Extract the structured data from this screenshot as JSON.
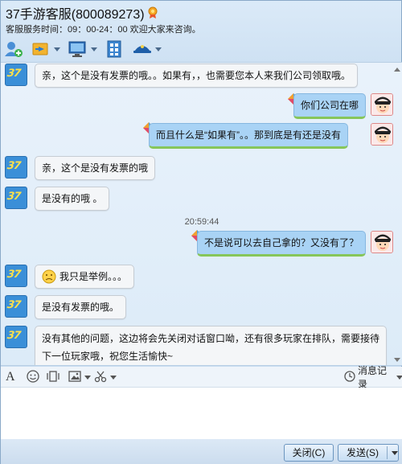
{
  "window": {
    "title": "37手游客服(800089273)",
    "service_hours": "客服服务时间：09：00-24：00 欢迎大家来咨询。"
  },
  "toolbar": {
    "buttons": [
      {
        "icon": "add-contact-icon"
      },
      {
        "icon": "transfer-file-icon"
      },
      {
        "icon": "remote-desktop-icon"
      },
      {
        "icon": "app-grid-icon"
      },
      {
        "icon": "user-status-icon"
      }
    ]
  },
  "chat": {
    "messages": [
      {
        "side": "left",
        "text": "亲，这个是没有发票的哦。。如果有，，也需要您本人来我们公司领取哦。"
      },
      {
        "side": "right",
        "text": "你们公司在哪"
      },
      {
        "side": "right",
        "text": "而且什么是“如果有”。。那到底是有还是没有"
      },
      {
        "side": "left",
        "text": "亲，这个是没有发票的哦"
      },
      {
        "side": "left",
        "text": "是没有的哦 。"
      },
      {
        "side": "right",
        "text": "不是说可以去自己拿的？又没有了？"
      },
      {
        "side": "left",
        "text": "我只是举例。。。"
      },
      {
        "side": "left",
        "text": "是没有发票的哦。"
      },
      {
        "side": "left",
        "line1": "没有其他的问题，这边将会先关闭对话窗口呦，还有很多玩家在排队，需要接待",
        "line2": "下一位玩家哦，祝您生活愉快~"
      }
    ],
    "timestamp": "20:59:44"
  },
  "input_toolbar": {
    "history_label": "消息记录"
  },
  "input": {
    "value": ""
  },
  "footer": {
    "close_label": "关闭(C)",
    "send_label": "发送(S)"
  },
  "colors": {
    "accent": "#2a7bd0",
    "bubble_right": "#a9d3f5",
    "bubble_left": "#f4f6f8",
    "status_underline": "#86c65a"
  }
}
